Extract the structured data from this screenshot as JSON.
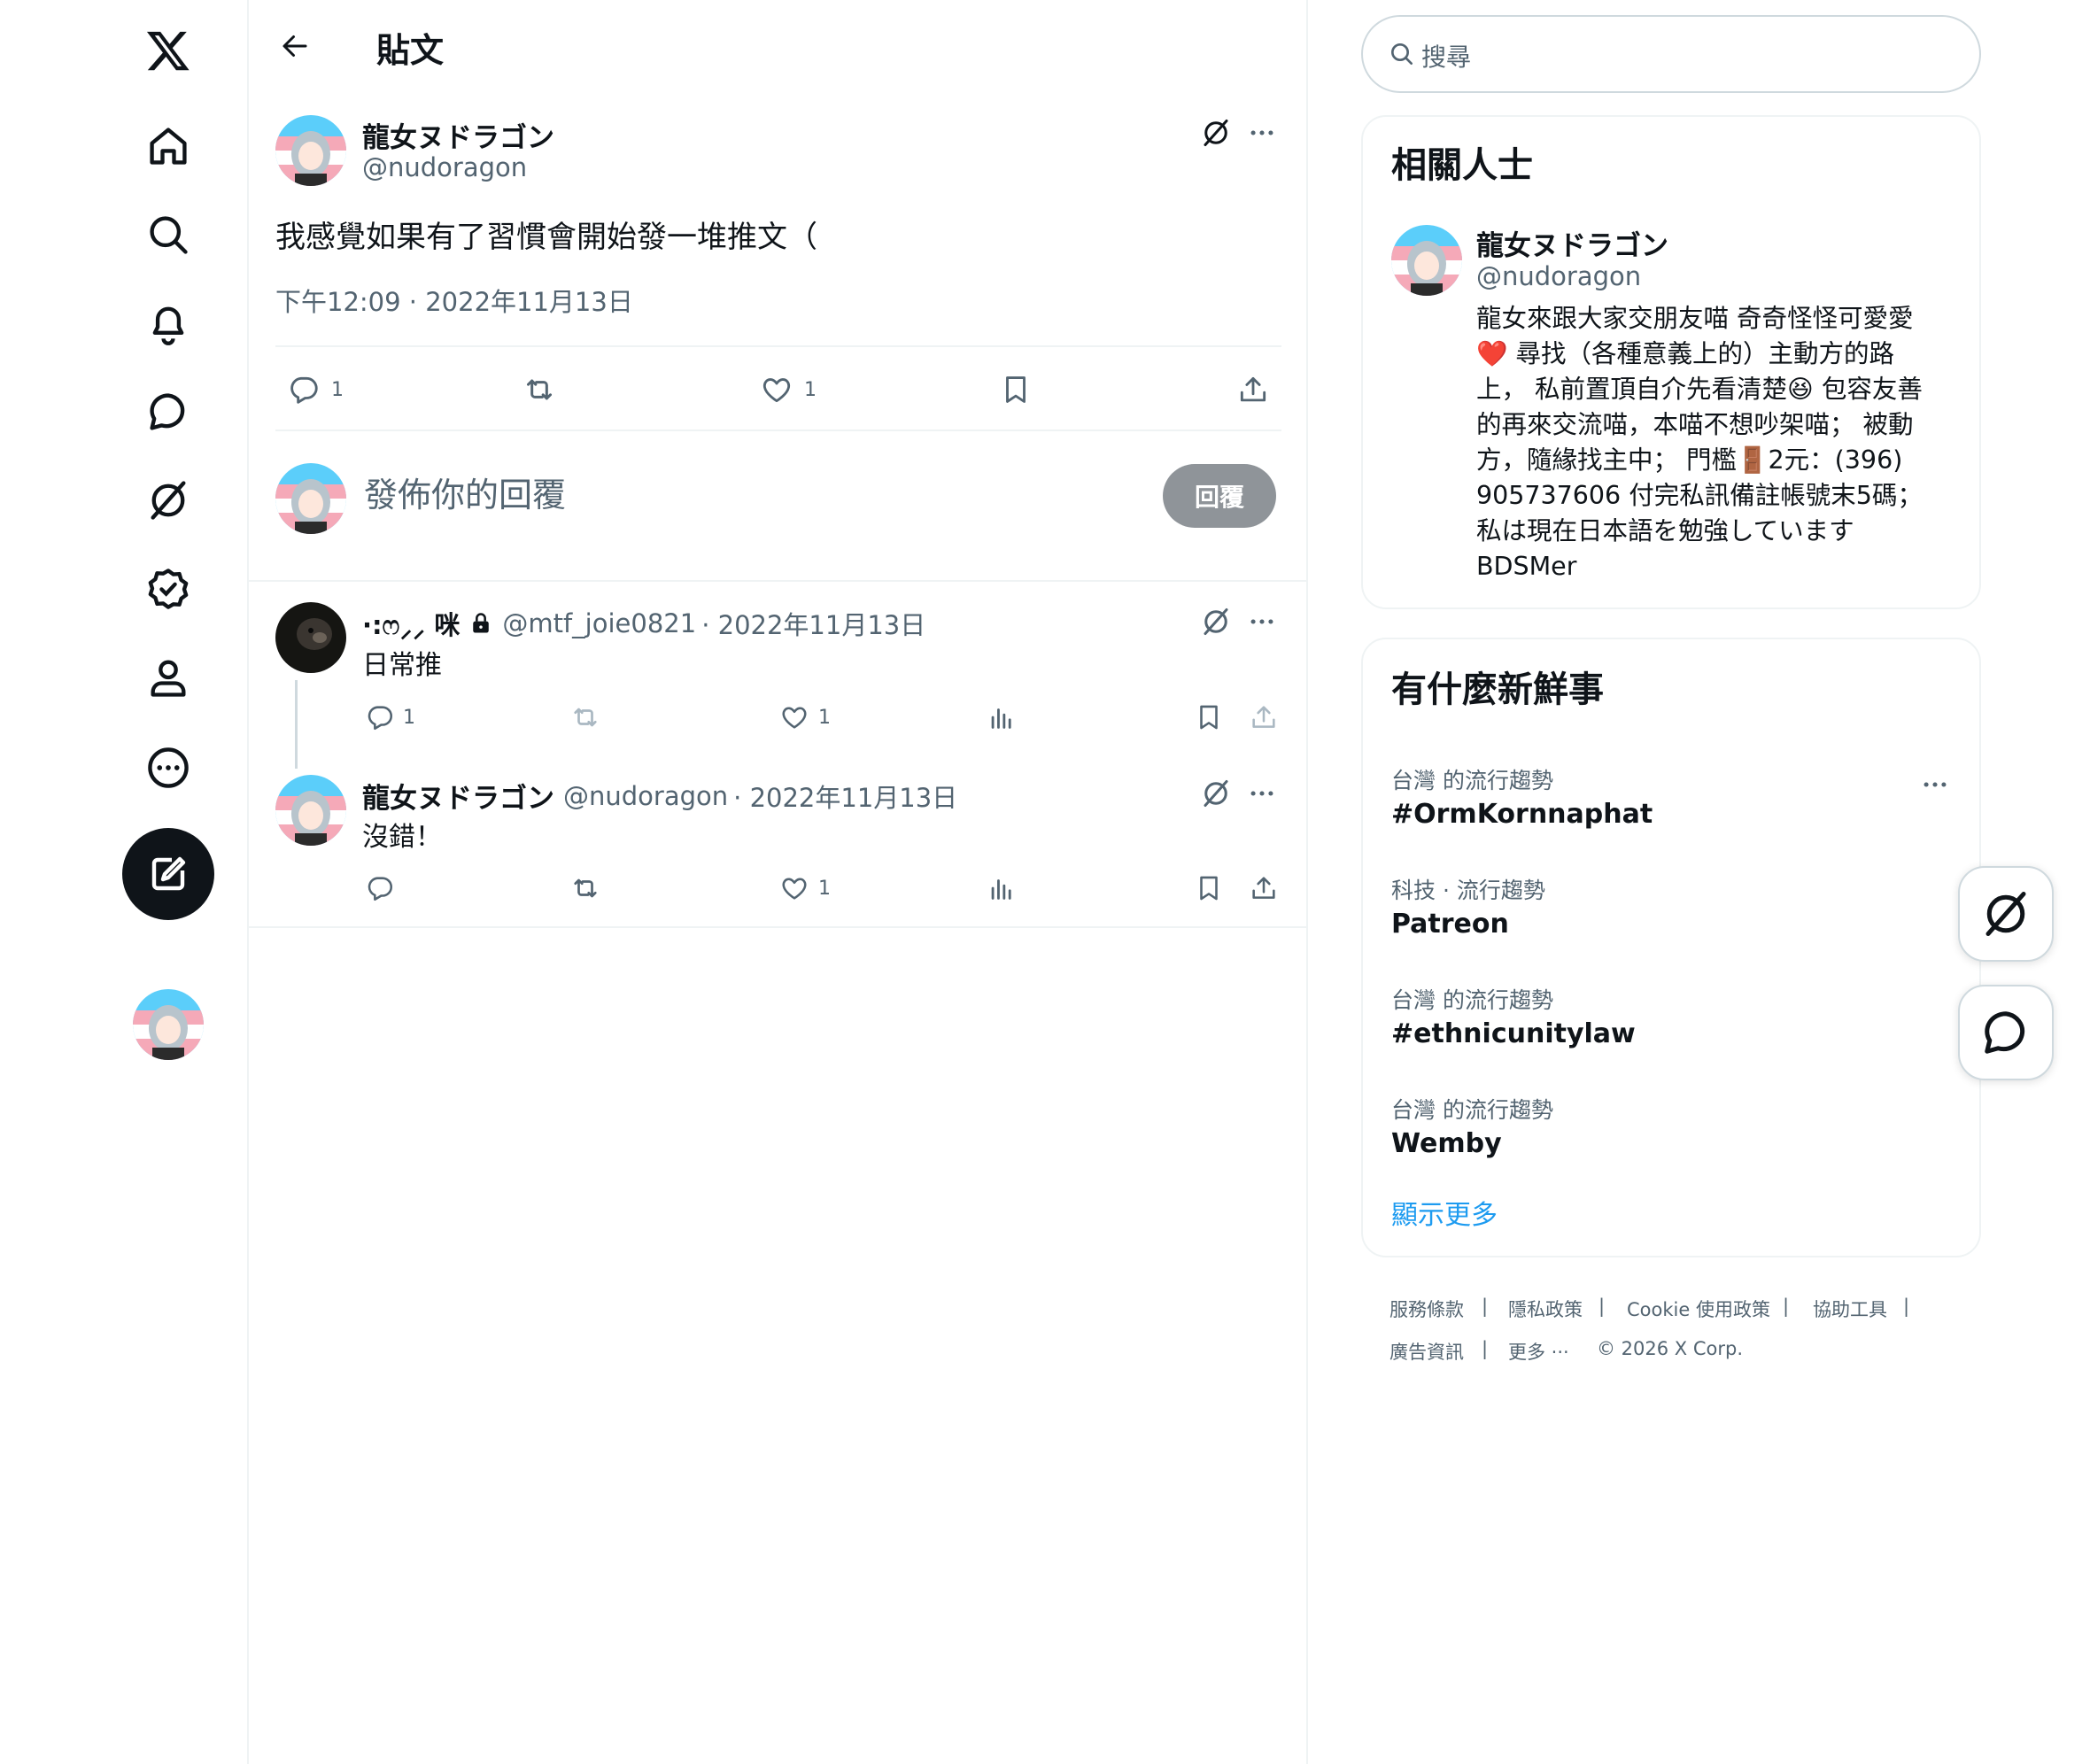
{
  "header": {
    "title": "貼文"
  },
  "post": {
    "author_name": "龍女ヌドラゴン",
    "author_handle": "@nudoragon",
    "text": "我感覺如果有了習慣會開始發一堆推文（",
    "timestamp": "下午12:09 · 2022年11月13日",
    "reply_count": "1",
    "like_count": "1"
  },
  "compose": {
    "placeholder": "發佈你的回覆",
    "reply_button": "回覆"
  },
  "replies": [
    {
      "author_name": "·:ෆ⸝⸝ 咪",
      "author_handle": "@mtf_joie0821",
      "date": "· 2022年11月13日",
      "text": "日常推",
      "reply_count": "1",
      "like_count": "1"
    },
    {
      "author_name": "龍女ヌドラゴン",
      "author_handle": "@nudoragon",
      "date": "· 2022年11月13日",
      "text": "沒錯！",
      "reply_count": "",
      "like_count": "1"
    }
  ],
  "search": {
    "placeholder": "搜尋"
  },
  "related": {
    "title": "相關人士",
    "name": "龍女ヌドラゴン",
    "handle": "@nudoragon",
    "bio": [
      "龍女來跟大家交朋友喵 奇奇怪怪可愛愛",
      "❤️ 尋找（各種意義上的）主動方的路",
      "上， 私前置頂自介先看清楚😆 包容友善",
      "的再來交流喵，本喵不想吵架喵； 被動",
      "方，隨緣找主中； 門檻🚪2元：(396)",
      "905737606 付完私訊備註帳號末5碼；",
      "私は現在日本語を勉強しています",
      "BDSMer"
    ]
  },
  "trends": {
    "title": "有什麼新鮮事",
    "items": [
      {
        "meta": "台灣 的流行趨勢",
        "name": "#OrmKornnaphat"
      },
      {
        "meta": "科技 · 流行趨勢",
        "name": "Patreon"
      },
      {
        "meta": "台灣 的流行趨勢",
        "name": "#ethnicunitylaw"
      },
      {
        "meta": "台灣 的流行趨勢",
        "name": "Wemby"
      }
    ],
    "show_more": "顯示更多"
  },
  "footer": {
    "links": [
      "服務條款",
      "|",
      "隱私政策",
      "|",
      "Cookie 使用政策",
      "|",
      "協助工具",
      "|",
      "廣告資訊",
      "|",
      "更多 ···",
      "© 2026 X Corp."
    ]
  },
  "colors": {
    "accent": "#1d9bf0",
    "text": "#0f1419",
    "muted": "#536471",
    "border": "#eff3f4"
  }
}
